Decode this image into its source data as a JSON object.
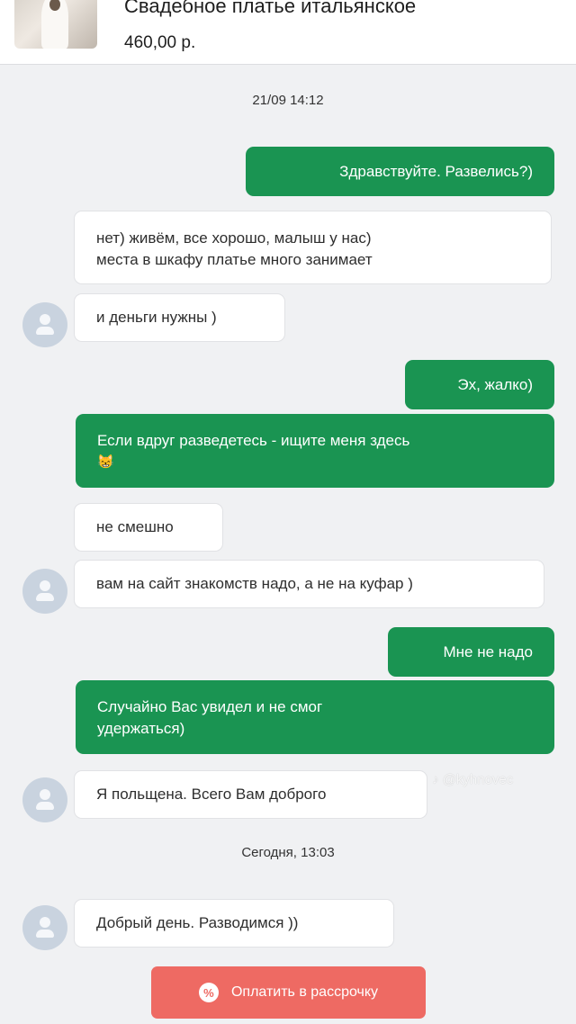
{
  "header": {
    "product_title": "Свадебное платье итальянское",
    "price": "460,00 р."
  },
  "timestamps": [
    "21/09 14:12",
    "Сегодня, 13:03"
  ],
  "messages": [
    {
      "from": "me",
      "text": "Здравствуйте. Развелись?)"
    },
    {
      "from": "seller",
      "lines": [
        "нет) живём, все хорошо, малыш у нас)",
        "места в шкафу платье много занимает"
      ]
    },
    {
      "from": "seller",
      "text": "и деньги нужны )"
    },
    {
      "from": "me",
      "text": "Эх, жалко)"
    },
    {
      "from": "me",
      "lines": [
        "Если вдруг разведетесь - ищите меня здесь",
        "😸"
      ]
    },
    {
      "from": "seller",
      "text": "не смешно"
    },
    {
      "from": "seller",
      "text": "вам на сайт знакомств надо, а не на куфар )"
    },
    {
      "from": "me",
      "text": "Мне не надо"
    },
    {
      "from": "me",
      "lines": [
        "Случайно Вас увидел и не смог",
        "удержаться)"
      ]
    },
    {
      "from": "seller",
      "text": "Я польщена. Всего Вам доброго"
    },
    {
      "from": "seller",
      "text": "Добрый день. Разводимся ))"
    }
  ],
  "watermark": "♪ @kyhnovec",
  "pay_button": {
    "icon": "%",
    "label": "Оплатить в рассрочку"
  },
  "colors": {
    "outgoing_bubble": "#1a9452",
    "incoming_bubble": "#ffffff",
    "pay_button": "#ee6a63",
    "background": "#f0f1f3"
  }
}
